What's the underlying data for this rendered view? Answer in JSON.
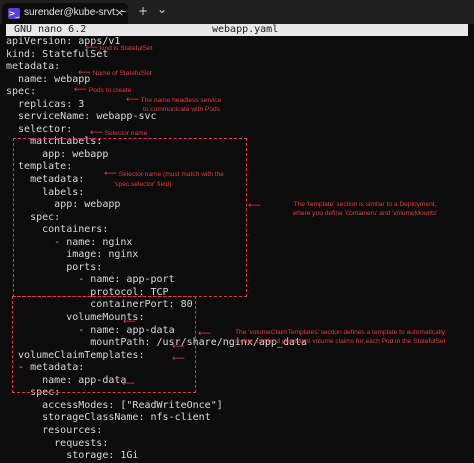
{
  "window": {
    "tab_label": "surender@kube-srvt: ~",
    "tab_icon": ">_",
    "close_glyph": "×",
    "new_tab_glyph": "+",
    "dropdown_glyph": "⌄"
  },
  "nano": {
    "app": "GNU nano 6.2",
    "filename": "webapp.yaml"
  },
  "code": {
    "l1_key": "apiVersion:",
    "l1_val": " apps/v1",
    "l2_key": "kind:",
    "l2_val": " StatefulSet",
    "l3_key": "metadata:",
    "l4_key": "  name:",
    "l4_val": " webapp",
    "l5_key": "spec:",
    "l6_key": "  replicas:",
    "l6_val": " 3",
    "l7_key": "  serviceName:",
    "l7_val": " webapp-svc",
    "l8_key": "  selector:",
    "l9_key": "    matchLabels:",
    "l10_key": "      app:",
    "l10_val": " webapp",
    "l11_key": "  template:",
    "l12_key": "    metadata:",
    "l13_key": "      labels:",
    "l14_key": "        app:",
    "l14_val": " webapp",
    "l15_key": "    spec:",
    "l16_key": "      containers:",
    "l17_dash": "        - ",
    "l17_key": "name:",
    "l17_val": " nginx",
    "l18_key": "          image:",
    "l18_val": " nginx",
    "l19_key": "          ports:",
    "l20_dash": "            - ",
    "l20_key": "name:",
    "l20_val": " app-port",
    "l21_key": "              protocol:",
    "l21_val": " TCP",
    "l22_key": "              containerPort:",
    "l22_val": " 80",
    "l23_key": "          volumeMounts:",
    "l24_dash": "            - ",
    "l24_key": "name:",
    "l24_val": " app-data",
    "l25_key": "              mountPath:",
    "l25_val": " /usr/share/nginx/app_data",
    "l26_key": "  volumeClaimTemplates:",
    "l27_dash": "  - ",
    "l27_key": "metadata:",
    "l28_key": "      name:",
    "l28_val": " app-data",
    "l29_key": "    spec:",
    "l30_key": "      accessModes:",
    "l30_val": " [\"ReadWriteOnce\"]",
    "l31_key": "      storageClassName:",
    "l31_val": " nfs-client",
    "l32_key": "      resources:",
    "l33_key": "        requests:",
    "l34_key": "          storage:",
    "l34_val": " 1Gi"
  },
  "annotations": {
    "kind": "kind is StatefulSet",
    "name": "Name of StatefulSet",
    "replicas": "Pods to create",
    "service_1": "The name headless service",
    "service_2": "to communicate with Pods",
    "selector": "Selector name",
    "template_sel_1": "Selector name (must match with the",
    "template_sel_2": "'spec.selector' field)",
    "template_box_1": "The 'template' section is similar to a Deployment,",
    "template_box_2": "where you define 'containers' and 'volumeMounts'",
    "vct_box_1": "The 'volumeClaimTemplates' section defines a template to automatically",
    "vct_box_2": "create and bind persistent volume claims for each Pod in the StatefulSet",
    "arrow": "⟵"
  },
  "colors": {
    "annotation": "#e23b3b",
    "keyword": "#d3a6f5",
    "background": "#0c0c0c"
  }
}
